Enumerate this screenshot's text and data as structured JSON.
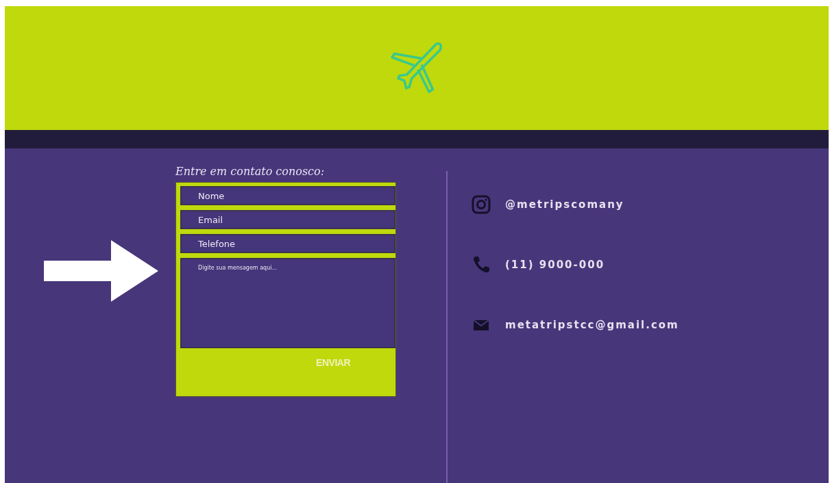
{
  "form": {
    "title": "Entre em contato conosco:",
    "fields": [
      {
        "placeholder": "Nome"
      },
      {
        "placeholder": "Email"
      },
      {
        "placeholder": "Telefone"
      }
    ],
    "message": {
      "placeholder": "Digite sua mensagem aqui..."
    },
    "submit": "ENVIAR"
  },
  "contacts": [
    {
      "kind": "instagram",
      "text": "@metripscomany"
    },
    {
      "kind": "phone",
      "text": "(11) 9000-000"
    },
    {
      "kind": "email",
      "text": "metatripstcc@gmail.com"
    }
  ]
}
